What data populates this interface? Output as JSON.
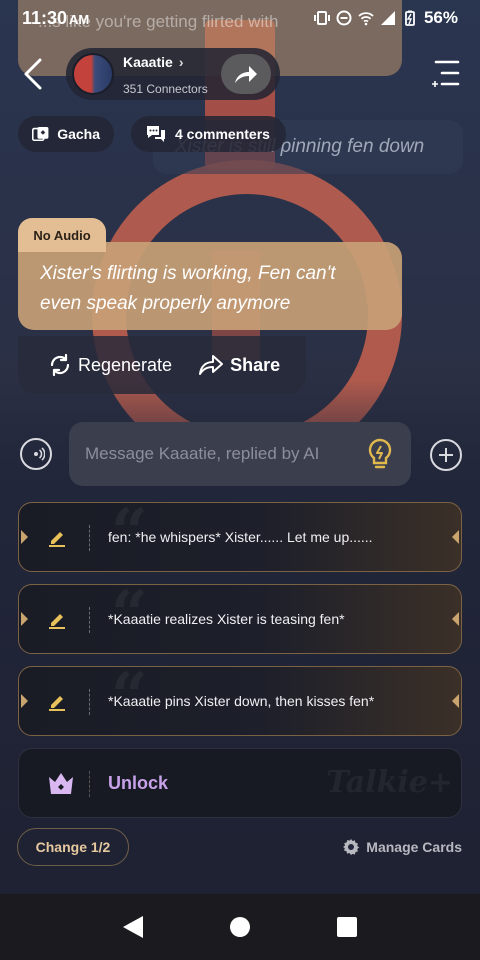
{
  "status_bar": {
    "time": "11:30",
    "ampm": "AM",
    "battery": "56%"
  },
  "background_message": {
    "text": "...s like you're getting flirted with"
  },
  "header": {
    "character_name": "Kaaatie",
    "connectors": "351 Connectors",
    "chevron": "›"
  },
  "chips": {
    "gacha": "Gacha",
    "comments": "4 commenters",
    "comment_preview": "Xister is still pinning fen down"
  },
  "message": {
    "badge": "No Audio",
    "text": "Xister's flirting is working, Fen can't even speak properly anymore"
  },
  "actions": {
    "regenerate": "Regenerate",
    "share": "Share"
  },
  "composer": {
    "placeholder": "Message Kaaatie, replied by AI"
  },
  "suggestions": [
    {
      "text": "fen: *he whispers* Xister...... Let me up......"
    },
    {
      "text": "*Kaaatie realizes Xister is teasing fen*"
    },
    {
      "text": "*Kaaatie pins Xister down, then kisses fen*"
    }
  ],
  "unlock": {
    "label": "Unlock",
    "watermark": "Talkie+"
  },
  "footer": {
    "change": "Change 1/2",
    "manage": "Manage Cards"
  },
  "colors": {
    "bubble": "#c8a076",
    "badge": "#e3bd93",
    "unlock": "#c7a2e8",
    "card_border": "#7c6244"
  }
}
